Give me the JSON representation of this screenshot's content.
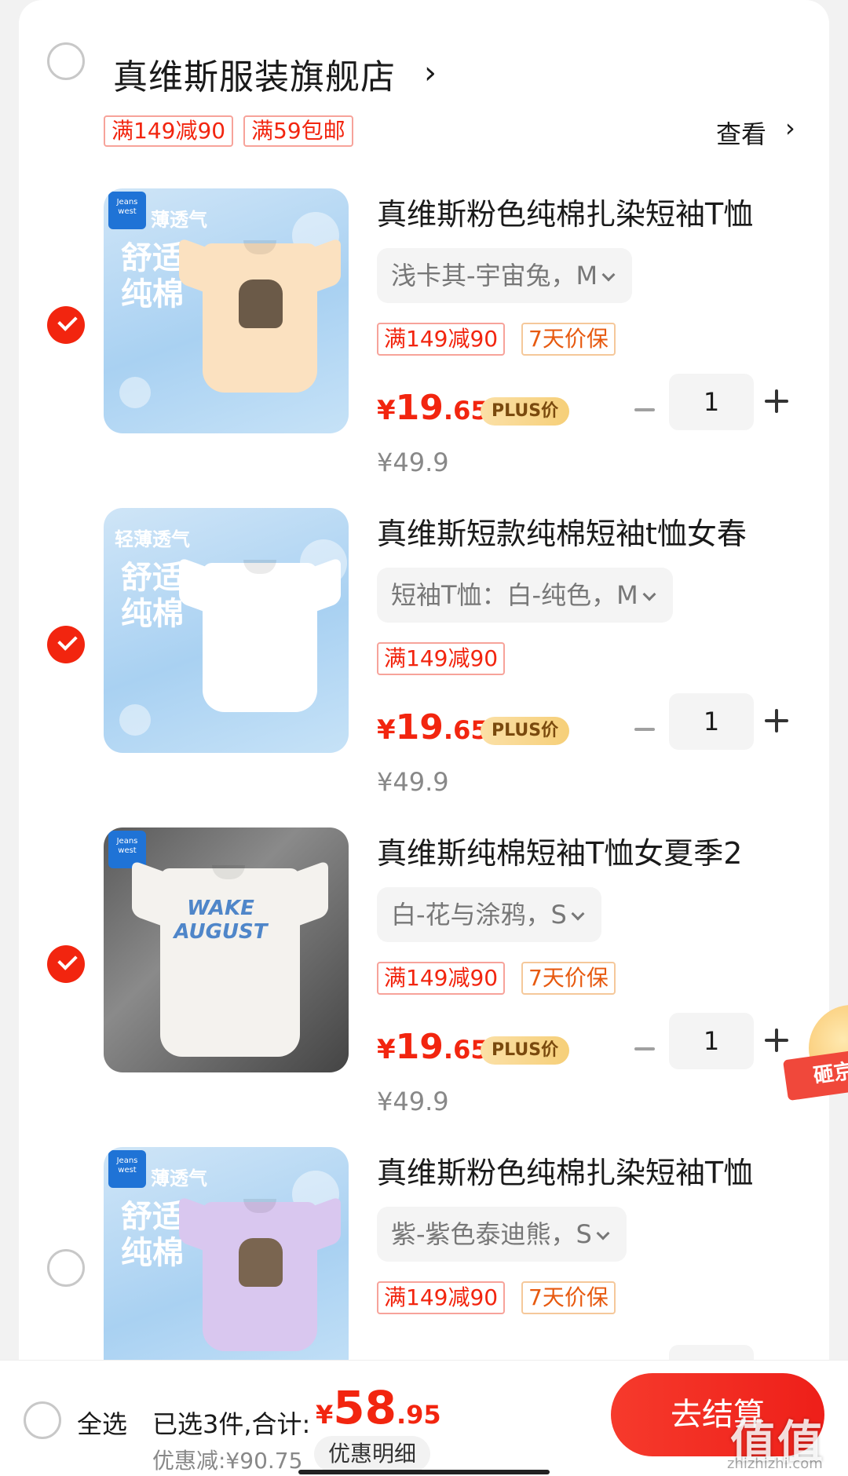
{
  "store": {
    "name": "真维斯服装旗舰店",
    "chevron": "›",
    "tags": [
      "满149减90",
      "满59包邮"
    ],
    "view_more": "查看",
    "view_more_chevron": "›"
  },
  "items": [
    {
      "selected": true,
      "title": "真维斯粉色纯棉扎染短袖T恤",
      "spec": "浅卡其-宇宙兔，M",
      "tags": [
        "满149减90",
        "7天价保"
      ],
      "price_symbol": "¥",
      "price_int": "19",
      "price_dec": ".65",
      "plus_label": "PLUS价",
      "original_price": "¥49.9",
      "quantity": "1",
      "image": {
        "brand": "Jeans west",
        "slogan_top": "薄透气",
        "slogan": "舒适纯棉",
        "shirt_color": "#fbe1c0",
        "print_color": "#6b5a48"
      }
    },
    {
      "selected": true,
      "title": "真维斯短款纯棉短袖t恤女春",
      "spec": "短袖T恤：白-纯色，M",
      "tags": [
        "满149减90"
      ],
      "price_symbol": "¥",
      "price_int": "19",
      "price_dec": ".65",
      "plus_label": "PLUS价",
      "original_price": "¥49.9",
      "quantity": "1",
      "image": {
        "brand": "",
        "slogan_top": "轻薄透气",
        "slogan": "舒适纯棉",
        "shirt_color": "#ffffff",
        "print_color": ""
      }
    },
    {
      "selected": true,
      "title": "真维斯纯棉短袖T恤女夏季2",
      "spec": "白-花与涂鸦，S",
      "tags": [
        "满149减90",
        "7天价保"
      ],
      "price_symbol": "¥",
      "price_int": "19",
      "price_dec": ".65",
      "plus_label": "PLUS价",
      "original_price": "¥49.9",
      "quantity": "1",
      "image": {
        "brand": "Jeans west",
        "slogan_top": "",
        "slogan": "",
        "shirt_color": "#f4f2ee",
        "print_text": "WAKE AUGUST"
      }
    },
    {
      "selected": false,
      "title": "真维斯粉色纯棉扎染短袖T恤",
      "spec": "紫-紫色泰迪熊，S",
      "tags": [
        "满149减90",
        "7天价保"
      ],
      "price_symbol": "",
      "price_int": "",
      "price_dec": "",
      "plus_label": "",
      "original_price": "",
      "quantity": "",
      "image": {
        "brand": "Jeans west",
        "slogan_top": "薄透气",
        "slogan": "舒适纯棉",
        "shirt_color": "#d9c7ef",
        "print_color": "#7a6550"
      }
    }
  ],
  "floating_badge": {
    "text": "砸京"
  },
  "footer": {
    "select_all": "全选",
    "selected_count": "已选3件,合计:",
    "total_symbol": "¥",
    "total_int": "58",
    "total_dec": ".95",
    "discount": "优惠减:¥90.75",
    "detail_button": "优惠明细",
    "checkout_button": "去结算",
    "watermark": "值值值",
    "watermark_sub": "zhizhizhi.com"
  },
  "colors": {
    "accent": "#f2250f",
    "plus_gold": "#f6cf78",
    "tag_border": "#f7a39a"
  }
}
